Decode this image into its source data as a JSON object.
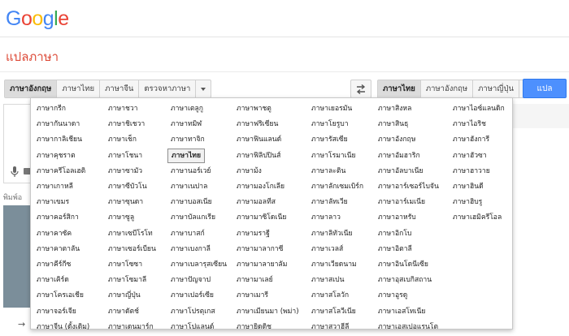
{
  "logo": "Google",
  "page_title": "แปลภาษา",
  "source_tabs": [
    "ภาษาอังกฤษ",
    "ภาษาไทย",
    "ภาษาจีน",
    "ตรวจหาภาษา"
  ],
  "target_tabs": [
    "ภาษาไทย",
    "ภาษาอังกฤษ",
    "ภาษาญี่ปุ่น"
  ],
  "translate_label": "แปล",
  "hint_text": "พิมพ์อ",
  "selected_language": "ภาษาไทย",
  "languages": [
    [
      "ภาษากรีก",
      "ภาษากันนาดา",
      "ภาษากาลิเชียน",
      "ภาษาคุชราต",
      "ภาษาครีโอลเฮติ",
      "ภาษาเกาหลี",
      "ภาษาเขมร",
      "ภาษาคอร์สิกา",
      "ภาษาคาซัค",
      "ภาษาคาตาลัน",
      "ภาษาคีร์กีซ",
      "ภาษาเคิร์ด",
      "ภาษาโครเอเชีย",
      "ภาษาจอร์เจีย",
      "ภาษาจีน (ดั้งเดิม)",
      "ภาษาจีน (แบบย่อ)"
    ],
    [
      "ภาษาชวา",
      "ภาษาชิเชวา",
      "ภาษาเช็ก",
      "ภาษาโชนา",
      "ภาษาซามัว",
      "ภาษาซีบัวโน",
      "ภาษาซุนดา",
      "ภาษาซูลู",
      "ภาษาเซบีโรโท",
      "ภาษาเซอร์เบียน",
      "ภาษาโซซา",
      "ภาษาโซมาลี",
      "ภาษาญี่ปุ่น",
      "ภาษาดัตช์",
      "ภาษาเดนมาร์ก",
      "ภาษาตุรกี"
    ],
    [
      "ภาษาเตลูกู",
      "ภาษาทมิฬ",
      "ภาษาทาจิก",
      "ภาษาไทย",
      "ภาษานอร์เวย์",
      "ภาษาเนปาล",
      "ภาษาบอสเนีย",
      "ภาษาบัลแกเรีย",
      "ภาษาบาสก์",
      "ภาษาเบงกาลี",
      "ภาษาเบลารุสเซียน",
      "ภาษาปัญจาป",
      "ภาษาเปอร์เซีย",
      "ภาษาโปรตุเกส",
      "ภาษาโปแลนด์",
      "ภาษาฝรั่งเศส"
    ],
    [
      "ภาษาพาชตู",
      "ภาษาฟริเซียน",
      "ภาษาฟินแลนด์",
      "ภาษาฟิลิปปินส์",
      "ภาษาม้ง",
      "ภาษามองโกเลีย",
      "ภาษามอลทีส",
      "ภาษามาซิโดเนีย",
      "ภาษามราฐี",
      "ภาษามาลากาซี",
      "ภาษามาลายาลัม",
      "ภาษามาเลย์",
      "ภาษาเมารี",
      "ภาษาเมียนมา (พม่า)",
      "ภาษายิดดิช",
      "ภาษายูเครน"
    ],
    [
      "ภาษาเยอรมัน",
      "ภาษาโยรูบา",
      "ภาษารัสเซีย",
      "ภาษาโรมาเนีย",
      "ภาษาละติน",
      "ภาษาลักเซมเบิร์ก",
      "ภาษาลัทเวีย",
      "ภาษาลาว",
      "ภาษาลิทัวเนีย",
      "ภาษาเวลส์",
      "ภาษาเวียดนาม",
      "ภาษาสเปน",
      "ภาษาสโลวัก",
      "ภาษาสโลวีเนีย",
      "ภาษาสวาฮีลี",
      "ภาษาสวีเดน"
    ],
    [
      "ภาษาสิงหล",
      "ภาษาสินธุ",
      "ภาษาอังกฤษ",
      "ภาษาอัมฮาริก",
      "ภาษาอัลบาเนีย",
      "ภาษาอาร์เซอร์ไบจัน",
      "ภาษาอาร์เมเนีย",
      "ภาษาอาหรับ",
      "ภาษาอิกโบ",
      "ภาษาอิตาลี",
      "ภาษาอินโดนีเซีย",
      "ภาษาอุสเบกิสถาน",
      "ภาษาอูรดู",
      "ภาษาเอสโทเนีย",
      "ภาษาเอสเปอแรนโต",
      "ภาษาแอฟริกา"
    ],
    [
      "ภาษาไอซ์แลนดิก",
      "ภาษาไอริช",
      "ภาษาฮังการี",
      "ภาษาฮัวซา",
      "ภาษาฮาวาย",
      "ภาษาฮินดี",
      "ภาษาฮิบรู",
      "ภาษาเฮมิครีโอล"
    ]
  ]
}
